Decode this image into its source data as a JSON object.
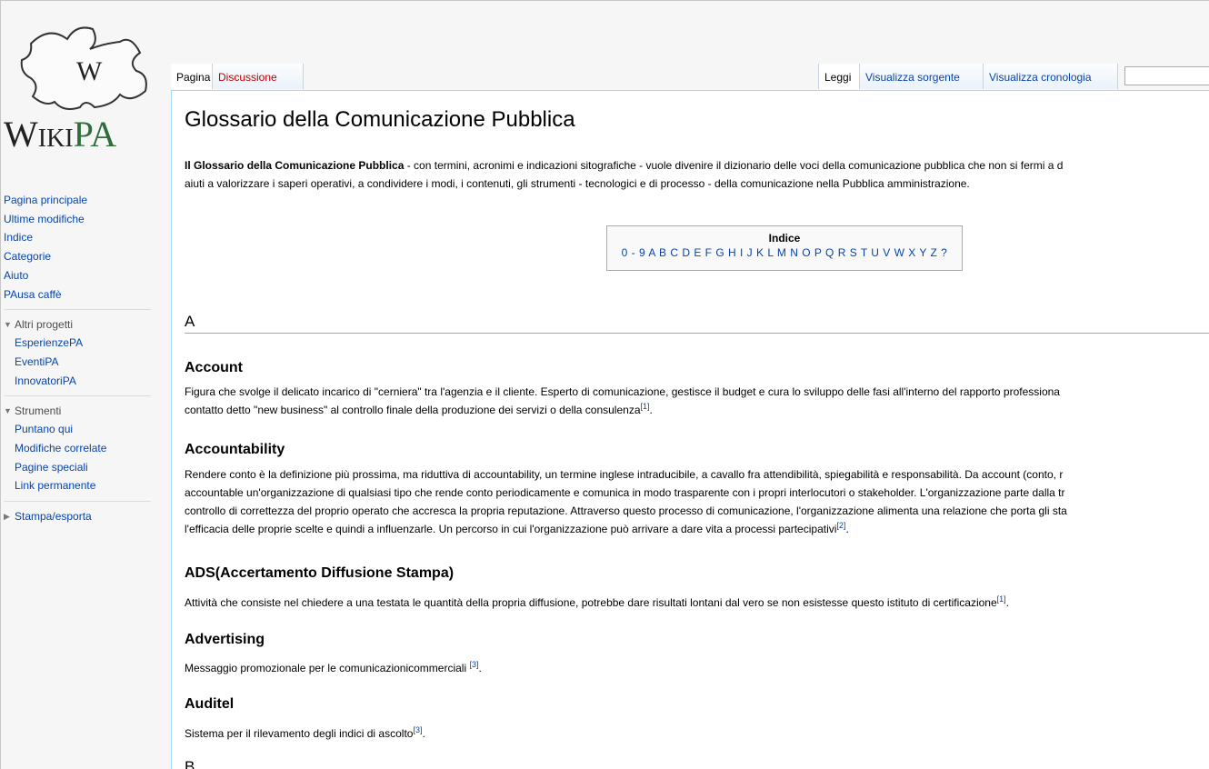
{
  "logo": {
    "text_main": "Wiki",
    "text_accent": "PA",
    "puzzle_letter": "W"
  },
  "sidebar": {
    "nav": [
      "Pagina principale",
      "Ultime modifiche",
      "Indice",
      "Categorie",
      "Aiuto",
      "PAusa caffè"
    ],
    "sections": [
      {
        "title": "Altri progetti",
        "expanded": true,
        "items": [
          "EsperienzePA",
          "EventiPA",
          "InnovatoriPA"
        ]
      },
      {
        "title": "Strumenti",
        "expanded": true,
        "items": [
          "Puntano qui",
          "Modifiche correlate",
          "Pagine speciali",
          "Link permanente"
        ]
      },
      {
        "title": "Stampa/esporta",
        "expanded": false,
        "items": []
      }
    ]
  },
  "tabs": {
    "left": [
      "Pagina",
      "Discussione"
    ],
    "right": [
      "Leggi",
      "Visualizza sorgente",
      "Visualizza cronologia"
    ]
  },
  "page": {
    "title": "Glossario della Comunicazione Pubblica",
    "intro_bold": "Il Glossario della Comunicazione Pubblica",
    "intro_rest_line1": " - con termini, acronimi e indicazioni sitografiche - vuole divenire il dizionario delle voci della comunicazione pubblica che non si fermi a d",
    "intro_line2": "aiuti a valorizzare i saperi operativi, a condividere i modi, i contenuti, gli strumenti - tecnologici e di processo - della comunicazione nella Pubblica amministrazione.",
    "toc_title": "Indice",
    "toc_letters": "0 - 9 A B C D E F G H I J K L M N O P Q R S T U V W X Y Z ?",
    "section_A": "A",
    "section_B": "B"
  },
  "entries": [
    {
      "term": "Account",
      "lines": [
        "Figura che svolge il delicato incarico di \"cerniera\" tra l'agenzia e il cliente. Esperto di comunicazione, gestisce il budget e cura lo sviluppo delle fasi all'interno del rapporto professiona",
        "contatto detto \"new business\" al controllo finale della produzione dei servizi o della consulenza"
      ],
      "ref": "[1]"
    },
    {
      "term": "Accountability",
      "lines": [
        "Rendere conto è la definizione più prossima, ma riduttiva di accountability, un termine inglese intraducibile, a cavallo fra attendibilità, spiegabilità e responsabilità. Da account (conto, r",
        "accountable un'organizzazione di qualsiasi tipo che rende conto periodicamente e comunica in modo trasparente con i propri interlocutori o stakeholder. L'organizzazione parte dalla tr",
        "controllo di correttezza del proprio operato che accresca la propria reputazione. Attraverso questo processo di comunicazione, l'organizzazione alimenta una relazione che porta gli sta",
        "l'efficacia delle proprie scelte e quindi a influenzarle. Un percorso in cui l'organizzazione può arrivare a dare vita a processi partecipativi"
      ],
      "ref": "[2]"
    },
    {
      "term": "ADS(Accertamento Diffusione Stampa)",
      "lines": [
        "Attività che consiste nel chiedere a una testata le quantità della propria diffusione, potrebbe dare risultati lontani dal vero se non esistesse questo istituto di certificazione"
      ],
      "ref": "[1]"
    },
    {
      "term": "Advertising",
      "lines": [
        "Messaggio promozionale per le comunicazionicommerciali "
      ],
      "ref": "[3]"
    },
    {
      "term": "Auditel",
      "lines": [
        "Sistema per il rilevamento degli indici di ascolto"
      ],
      "ref": "[3]"
    }
  ],
  "colors": {
    "link": "#0645ad",
    "redlink": "#ba0000",
    "logo_accent": "#2f6e3a",
    "border": "#a7d7f9"
  }
}
